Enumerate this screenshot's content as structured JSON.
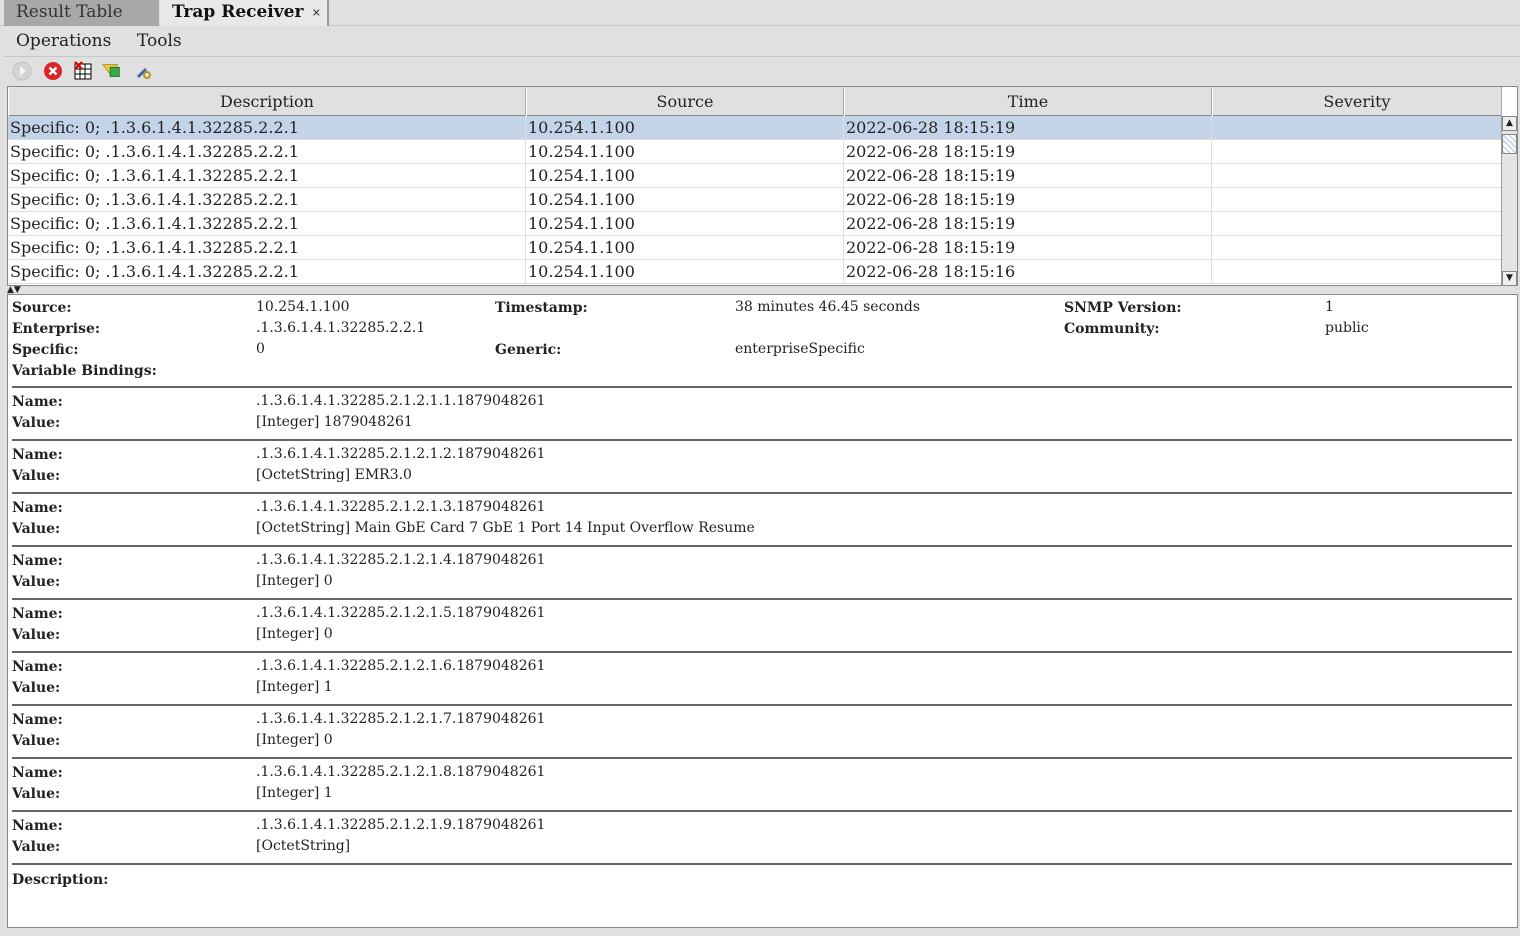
{
  "tabs": [
    {
      "label": "Result Table"
    },
    {
      "label": "Trap Receiver",
      "close": "×"
    }
  ],
  "menu": [
    "Operations",
    "Tools"
  ],
  "toolbar": [
    {
      "icon": "play-icon"
    },
    {
      "icon": "stop-icon"
    },
    {
      "icon": "clear-table-icon"
    },
    {
      "icon": "filter-icon"
    },
    {
      "icon": "settings-icon"
    }
  ],
  "table": {
    "columns": [
      "Description",
      "Source",
      "Time",
      "Severity"
    ],
    "rows": [
      [
        "Specific: 0; .1.3.6.1.4.1.32285.2.2.1",
        "10.254.1.100",
        "2022-06-28 18:15:19",
        ""
      ],
      [
        "Specific: 0; .1.3.6.1.4.1.32285.2.2.1",
        "10.254.1.100",
        "2022-06-28 18:15:19",
        ""
      ],
      [
        "Specific: 0; .1.3.6.1.4.1.32285.2.2.1",
        "10.254.1.100",
        "2022-06-28 18:15:19",
        ""
      ],
      [
        "Specific: 0; .1.3.6.1.4.1.32285.2.2.1",
        "10.254.1.100",
        "2022-06-28 18:15:19",
        ""
      ],
      [
        "Specific: 0; .1.3.6.1.4.1.32285.2.2.1",
        "10.254.1.100",
        "2022-06-28 18:15:19",
        ""
      ],
      [
        "Specific: 0; .1.3.6.1.4.1.32285.2.2.1",
        "10.254.1.100",
        "2022-06-28 18:15:19",
        ""
      ],
      [
        "Specific: 0; .1.3.6.1.4.1.32285.2.2.1",
        "10.254.1.100",
        "2022-06-28 18:15:16",
        ""
      ]
    ]
  },
  "detail": {
    "source_label": "Source:",
    "source": "10.254.1.100",
    "enterprise_label": "Enterprise:",
    "enterprise": ".1.3.6.1.4.1.32285.2.2.1",
    "specific_label": "Specific:",
    "specific": "0",
    "varbinds_label": "Variable Bindings:",
    "timestamp_label": "Timestamp:",
    "timestamp": "38 minutes 46.45 seconds",
    "generic_label": "Generic:",
    "generic": "enterpriseSpecific",
    "snmp_label": "SNMP Version:",
    "snmp": "1",
    "community_label": "Community:",
    "community": "public",
    "name_label": "Name:",
    "value_label": "Value:",
    "description_label": "Description:",
    "bindings": [
      {
        "name": ".1.3.6.1.4.1.32285.2.1.2.1.1.1879048261",
        "value": "[Integer] 1879048261"
      },
      {
        "name": ".1.3.6.1.4.1.32285.2.1.2.1.2.1879048261",
        "value": "[OctetString] EMR3.0"
      },
      {
        "name": ".1.3.6.1.4.1.32285.2.1.2.1.3.1879048261",
        "value": "[OctetString] Main GbE Card 7 GbE 1 Port 14 Input Overflow Resume"
      },
      {
        "name": ".1.3.6.1.4.1.32285.2.1.2.1.4.1879048261",
        "value": "[Integer] 0"
      },
      {
        "name": ".1.3.6.1.4.1.32285.2.1.2.1.5.1879048261",
        "value": "[Integer] 0"
      },
      {
        "name": ".1.3.6.1.4.1.32285.2.1.2.1.6.1879048261",
        "value": "[Integer] 1"
      },
      {
        "name": ".1.3.6.1.4.1.32285.2.1.2.1.7.1879048261",
        "value": "[Integer] 0"
      },
      {
        "name": ".1.3.6.1.4.1.32285.2.1.2.1.8.1879048261",
        "value": "[Integer] 1"
      },
      {
        "name": ".1.3.6.1.4.1.32285.2.1.2.1.9.1879048261",
        "value": "[OctetString]"
      }
    ]
  }
}
